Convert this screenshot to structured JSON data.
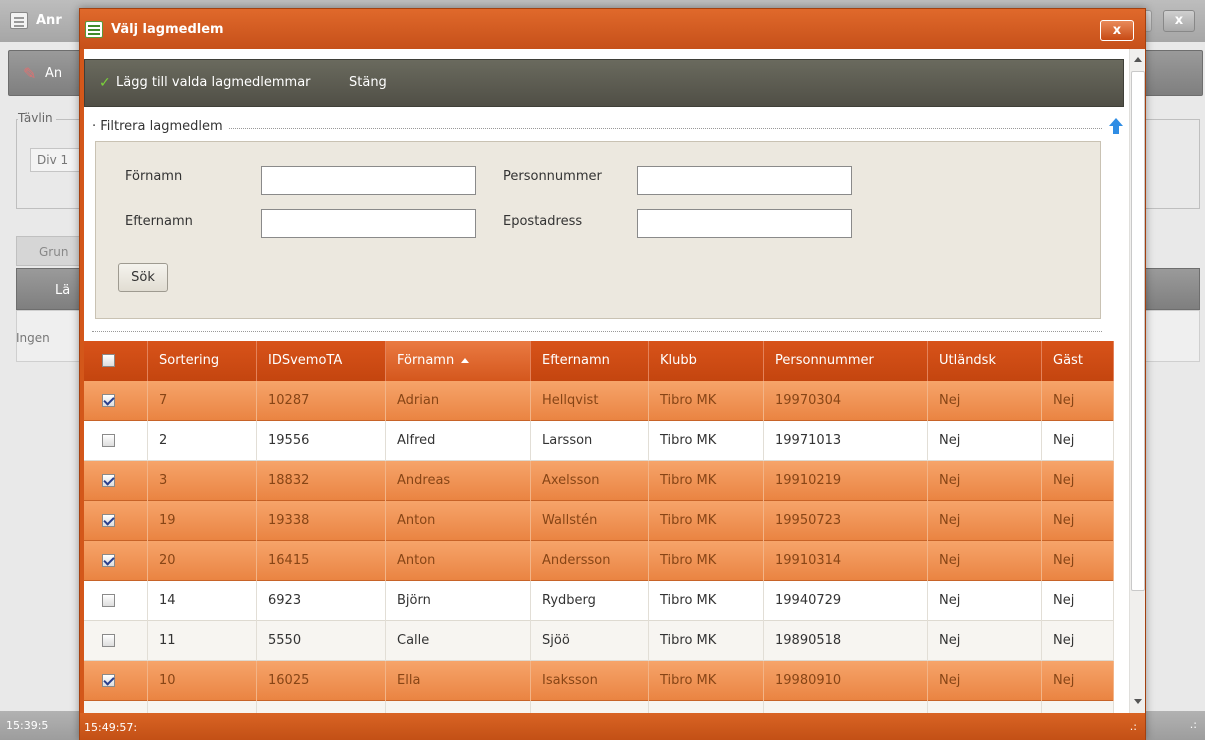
{
  "background_window": {
    "title": "Anr",
    "toolbar_label": "An",
    "fieldset_legend": "Tävlin",
    "select_value": "Div 1",
    "tab_label": "Grun",
    "toolbar2_label": "Lä",
    "content_text": "Ingen",
    "status_time": "15:39:5",
    "close_glyph": "x"
  },
  "dialog": {
    "title": "Välj lagmedlem",
    "close_glyph": "x",
    "toolbar": {
      "add_label": "Lägg till valda lagmedlemmar",
      "close_label": "Stäng"
    },
    "filter": {
      "legend": "Filtrera lagmedlem",
      "firstname_label": "Förnamn",
      "firstname_value": "",
      "lastname_label": "Efternamn",
      "lastname_value": "",
      "personnummer_label": "Personnummer",
      "personnummer_value": "",
      "email_label": "Epostadress",
      "email_value": "",
      "search_label": "Sök"
    },
    "status_time": "15:49:57:",
    "grip": ".:"
  },
  "grid": {
    "columns": [
      "Sortering",
      "IDSvemoTA",
      "Förnamn",
      "Efternamn",
      "Klubb",
      "Personnummer",
      "Utländsk",
      "Gäst"
    ],
    "sorted_column": "Förnamn",
    "sort_direction": "ascending",
    "rows": [
      {
        "selected": true,
        "cells": [
          "7",
          "10287",
          "Adrian",
          "Hellqvist",
          "Tibro MK",
          "19970304",
          "Nej",
          "Nej"
        ]
      },
      {
        "selected": false,
        "cells": [
          "2",
          "19556",
          "Alfred",
          "Larsson",
          "Tibro MK",
          "19971013",
          "Nej",
          "Nej"
        ]
      },
      {
        "selected": true,
        "cells": [
          "3",
          "18832",
          "Andreas",
          "Axelsson",
          "Tibro MK",
          "19910219",
          "Nej",
          "Nej"
        ]
      },
      {
        "selected": true,
        "cells": [
          "19",
          "19338",
          "Anton",
          "Wallstén",
          "Tibro MK",
          "19950723",
          "Nej",
          "Nej"
        ]
      },
      {
        "selected": true,
        "cells": [
          "20",
          "16415",
          "Anton",
          "Andersson",
          "Tibro MK",
          "19910314",
          "Nej",
          "Nej"
        ]
      },
      {
        "selected": false,
        "cells": [
          "14",
          "6923",
          "Björn",
          "Rydberg",
          "Tibro MK",
          "19940729",
          "Nej",
          "Nej"
        ]
      },
      {
        "selected": false,
        "cells": [
          "11",
          "5550",
          "Calle",
          "Sjöö",
          "Tibro MK",
          "19890518",
          "Nej",
          "Nej"
        ]
      },
      {
        "selected": true,
        "cells": [
          "10",
          "16025",
          "Ella",
          "Isaksson",
          "Tibro MK",
          "19980910",
          "Nej",
          "Nej"
        ]
      }
    ]
  },
  "colors": {
    "accent": "#d3571a",
    "selected_row": "#ea8442",
    "toolbar": "#504f46"
  }
}
